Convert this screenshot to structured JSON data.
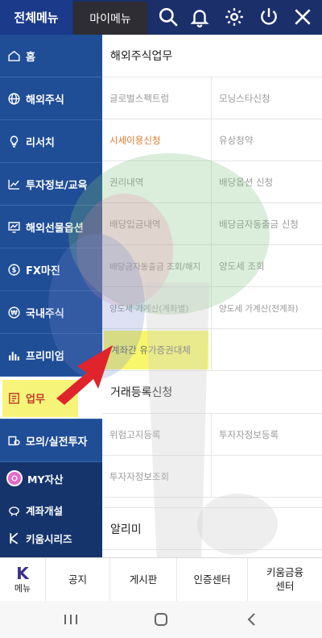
{
  "header": {
    "tab_all": "전체메뉴",
    "tab_my": "마이메뉴",
    "icons": [
      "search-icon",
      "bell-icon",
      "gear-icon",
      "power-icon",
      "close-icon"
    ]
  },
  "sidebar": {
    "items": [
      {
        "label": "홈",
        "icon": "home-icon"
      },
      {
        "label": "해외주식",
        "icon": "globe-icon"
      },
      {
        "label": "리서치",
        "icon": "lightbulb-icon"
      },
      {
        "label": "투자정보/교육",
        "icon": "chart-icon"
      },
      {
        "label": "해외선물옵션",
        "icon": "monitor-chart-icon"
      },
      {
        "label": "FX마진",
        "icon": "dollar-icon"
      },
      {
        "label": "국내주식",
        "icon": "won-icon"
      },
      {
        "label": "프리미엄",
        "icon": "bars-icon"
      },
      {
        "label": "업무",
        "icon": "clipboard-icon"
      },
      {
        "label": "모의/실전투자",
        "icon": "coins-icon"
      }
    ],
    "my_assets": "MY자산",
    "open_account": "계좌개설",
    "kiwoom_series": "키움시리즈"
  },
  "content": {
    "section1_title": "해외주식업무",
    "section1_rows": [
      [
        "글로벌스펙트럼",
        "모닝스타신청"
      ],
      [
        "시세이용신청",
        "유상청약"
      ],
      [
        "권리내역",
        "배당옵션 신청"
      ],
      [
        "배당입금내역",
        "배당금자동출금 신청"
      ],
      [
        "배당금자동출금 조회/해지",
        "양도세 조회"
      ],
      [
        "양도세 가계산(계좌별)",
        "양도세 가계산(전계좌)"
      ],
      [
        "계좌간 유가증권대체",
        ""
      ]
    ],
    "section2_title": "거래등록신청",
    "section2_rows": [
      [
        "위험고지등록",
        "투자자정보등록"
      ],
      [
        "투자자정보조회",
        ""
      ]
    ],
    "section3_title": "알리미",
    "highlight_color": "#f6f546",
    "accent_orange": "#e07a2e"
  },
  "bottom_tabs": {
    "menu_logo": "K",
    "menu_label": "메뉴",
    "notice": "공지",
    "board": "게시판",
    "cert_center": "인증센터",
    "kiwoom_finance": "키움금융\n센터"
  }
}
